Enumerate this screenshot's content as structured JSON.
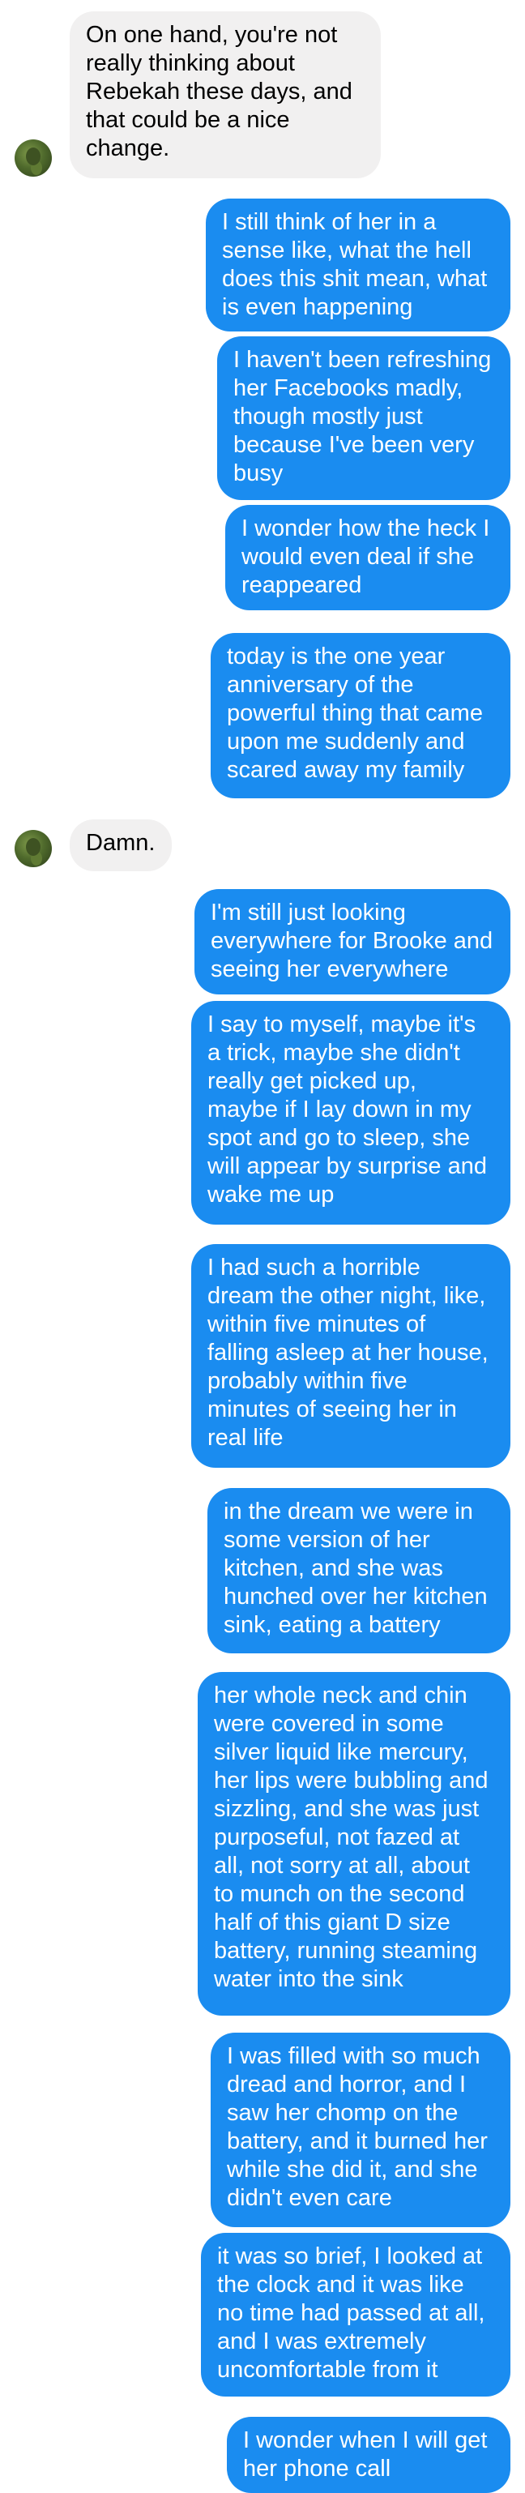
{
  "conversation": {
    "messages": [
      {
        "sender": "contact",
        "text": "On one hand, you're not\nreally thinking about\nRebekah these days, and\nthat could be a nice\nchange."
      },
      {
        "sender": "me",
        "text": "I still think of her in a\nsense like, what the hell\ndoes this shit mean, what\nis even happening"
      },
      {
        "sender": "me",
        "text": "I haven't been refreshing\nher Facebooks madly,\nthough mostly just\nbecause I've been very\nbusy"
      },
      {
        "sender": "me",
        "text": "I wonder how the heck I\nwould even deal if she\nreappeared"
      },
      {
        "sender": "me",
        "text": "today is the one year\nanniversary of the\npowerful thing that came\nupon me suddenly and\nscared away my family"
      },
      {
        "sender": "contact",
        "text": "Damn."
      },
      {
        "sender": "me",
        "text": "I'm still just looking\neverywhere for Brooke and\nseeing her everywhere"
      },
      {
        "sender": "me",
        "text": "I say to myself, maybe it's\na trick, maybe she didn't\nreally get picked up,\nmaybe if I lay down in my\nspot and go to sleep, she\nwill appear by surprise and\nwake me up"
      },
      {
        "sender": "me",
        "text": "I had such a horrible\ndream the other night, like,\nwithin five minutes of\nfalling asleep at her house,\nprobably within five\nminutes of seeing her in\nreal life"
      },
      {
        "sender": "me",
        "text": "in the dream we were in\nsome version of her\nkitchen, and she was\nhunched over her kitchen\nsink, eating a battery"
      },
      {
        "sender": "me",
        "text": "her whole neck and chin\nwere covered in some\nsilver liquid like mercury,\nher lips were bubbling and\nsizzling, and she was just\npurposeful, not fazed at\nall, not sorry at all, about\nto munch on the second\nhalf of this giant D size\nbattery, running steaming\nwater into the sink"
      },
      {
        "sender": "me",
        "text": "I was filled with so much\ndread and horror, and I\nsaw her chomp on the\nbattery, and it burned her\nwhile she did it, and she\ndidn't even care"
      },
      {
        "sender": "me",
        "text": "it was so brief, I looked at\nthe clock and it was like\nno time had passed at all,\nand I was extremely\nuncomfortable from it"
      },
      {
        "sender": "me",
        "text": "I wonder when I will get\nher phone call"
      }
    ]
  },
  "colors": {
    "outgoing_bubble": "#1a8cf0",
    "incoming_bubble": "#f1f0f0",
    "background": "#ffffff"
  },
  "icons": {
    "contact_avatar": "avatar"
  }
}
